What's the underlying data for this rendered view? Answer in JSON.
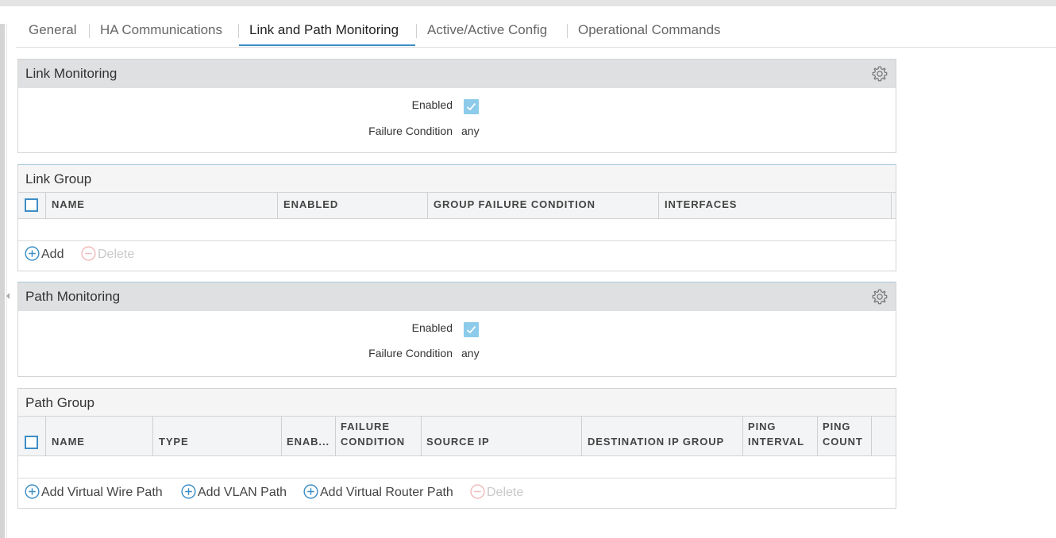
{
  "tabs": [
    {
      "label": "General"
    },
    {
      "label": "HA Communications"
    },
    {
      "label": "Link and Path Monitoring"
    },
    {
      "label": "Active/Active Config"
    },
    {
      "label": "Operational Commands"
    }
  ],
  "active_tab": "Link and Path Monitoring",
  "link_monitoring": {
    "title": "Link Monitoring",
    "enabled_label": "Enabled",
    "enabled": true,
    "failure_condition_label": "Failure Condition",
    "failure_condition_value": "any"
  },
  "link_group": {
    "title": "Link Group",
    "columns": [
      "NAME",
      "ENABLED",
      "GROUP FAILURE CONDITION",
      "INTERFACES"
    ],
    "rows": [],
    "add_label": "Add",
    "delete_label": "Delete"
  },
  "path_monitoring": {
    "title": "Path Monitoring",
    "enabled_label": "Enabled",
    "enabled": true,
    "failure_condition_label": "Failure Condition",
    "failure_condition_value": "any"
  },
  "path_group": {
    "title": "Path Group",
    "columns": [
      {
        "line1": "",
        "line2": "NAME"
      },
      {
        "line1": "",
        "line2": "TYPE"
      },
      {
        "line1": "",
        "line2": "ENAB..."
      },
      {
        "line1": "FAILURE",
        "line2": "CONDITION"
      },
      {
        "line1": "",
        "line2": "SOURCE IP"
      },
      {
        "line1": "",
        "line2": "DESTINATION IP GROUP"
      },
      {
        "line1": "PING",
        "line2": "INTERVAL"
      },
      {
        "line1": "PING",
        "line2": "COUNT"
      }
    ],
    "rows": [],
    "add_virtual_wire_label": "Add Virtual Wire Path",
    "add_vlan_label": "Add VLAN Path",
    "add_virtual_router_label": "Add Virtual Router Path",
    "delete_label": "Delete"
  },
  "colors": {
    "accent": "#3a8dc5",
    "checkbox_checked": "#8ccbea",
    "header_bg": "#dfe0e1",
    "delete_disabled": "#f0b9b9"
  }
}
